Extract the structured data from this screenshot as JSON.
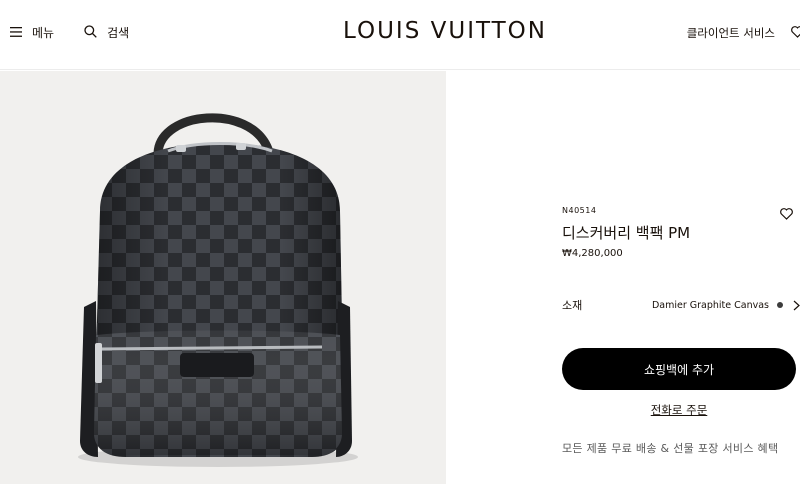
{
  "header": {
    "menu_label": "메뉴",
    "search_label": "검색",
    "logo": "LOUIS VUITTON",
    "client_service_label": "클라이언트 서비스",
    "icons": [
      "menu-icon",
      "search-icon",
      "heart-icon"
    ]
  },
  "product": {
    "sku": "N40514",
    "name": "디스커버리 백팩 PM",
    "price": "₩4,280,000",
    "material_label": "소재",
    "material_value": "Damier Graphite Canvas",
    "add_to_cart_label": "쇼핑백에 추가",
    "phone_order_label": "전화로 주문",
    "benefits_text": "모든 제품 무료 배송 & 선물 포장 서비스 혜택"
  },
  "colors": {
    "background_image_panel": "#f1f0ee",
    "button": "#000000",
    "text": "#19110b"
  }
}
